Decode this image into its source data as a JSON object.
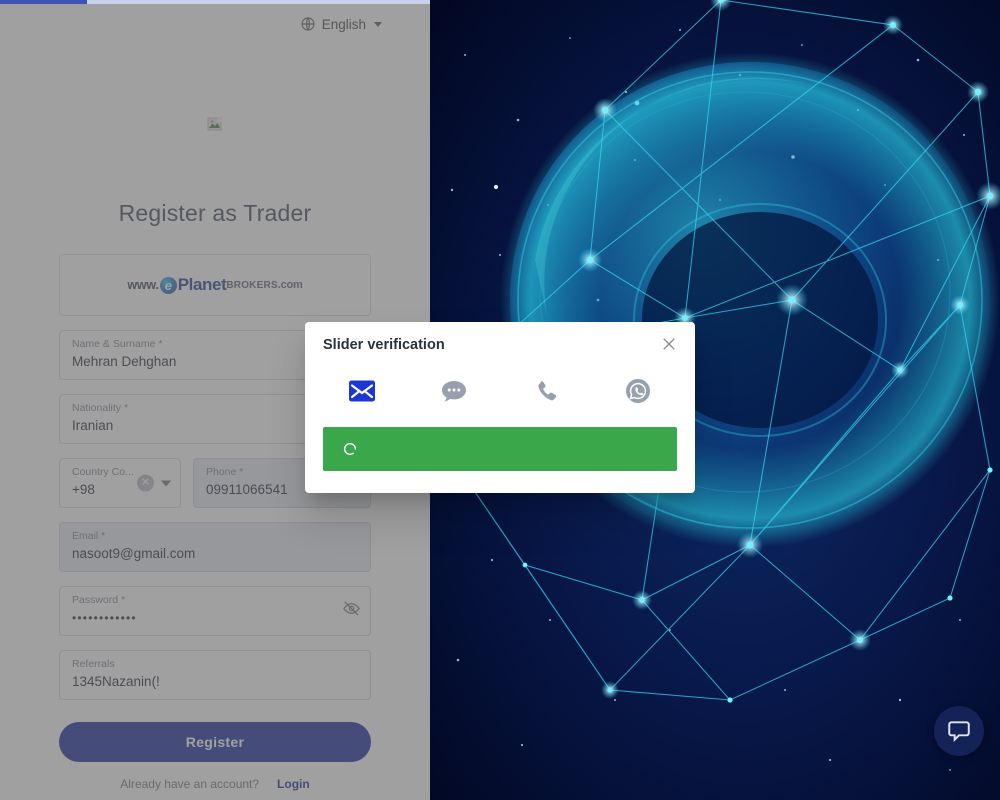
{
  "loading": {
    "progress_percent": 20
  },
  "header": {
    "language_label": "English",
    "globe_icon": "globe-icon",
    "caret_icon": "chevron-down-icon"
  },
  "brand": {
    "broken_image_icon": "broken-image-icon",
    "logo_www": "www.",
    "logo_e": "e",
    "logo_planet": "Planet",
    "logo_brokers": "BROKERS",
    "logo_com": ".com"
  },
  "form": {
    "title": "Register as Trader",
    "fields": [
      {
        "name": "name-surname",
        "label": "Name & Surname *",
        "value": "Mehran Dehghan",
        "placeholder": "Name & Surname"
      },
      {
        "name": "nationality",
        "label": "Nationality *",
        "value": "Iranian",
        "placeholder": "Nationality"
      },
      {
        "name": "country-code",
        "label": "Country Co...",
        "value": "+98",
        "placeholder": "Country Code"
      },
      {
        "name": "phone",
        "label": "Phone *",
        "value": "09911066541",
        "placeholder": "Phone"
      },
      {
        "name": "email",
        "label": "Email *",
        "value": "nasoot9@gmail.com",
        "placeholder": "Email"
      },
      {
        "name": "password",
        "label": "Password *",
        "value": "••••••••••••",
        "placeholder": "Password"
      },
      {
        "name": "referrals",
        "label": "Referrals",
        "value": "1345Nazanin(!",
        "placeholder": "Referrals"
      }
    ],
    "clear_icon": "clear-circle-icon",
    "dropdown_icon": "chevron-down-icon",
    "password_toggle_icon": "eye-off-icon",
    "register_label": "Register",
    "login_hint": "Already have an account?",
    "login_label": "Login"
  },
  "modal": {
    "title": "Slider verification",
    "close_icon": "close-icon",
    "channels": [
      {
        "name": "email-channel",
        "icon": "envelope-icon",
        "selected": true
      },
      {
        "name": "sms-channel",
        "icon": "chat-bubble-icon",
        "selected": false
      },
      {
        "name": "call-channel",
        "icon": "phone-icon",
        "selected": false
      },
      {
        "name": "whatsapp-channel",
        "icon": "whatsapp-icon",
        "selected": false
      }
    ],
    "slider_state": "loading",
    "slider_icon": "spinner-icon"
  },
  "chat": {
    "icon": "chat-widget-icon"
  },
  "colors": {
    "primary": "#14249a",
    "progress": "#3f51b5",
    "slider_green": "#3aa74a",
    "envelope_blue": "#1a37d6",
    "muted_gray": "#97a0ad",
    "hero_dark": "#030b2e"
  }
}
